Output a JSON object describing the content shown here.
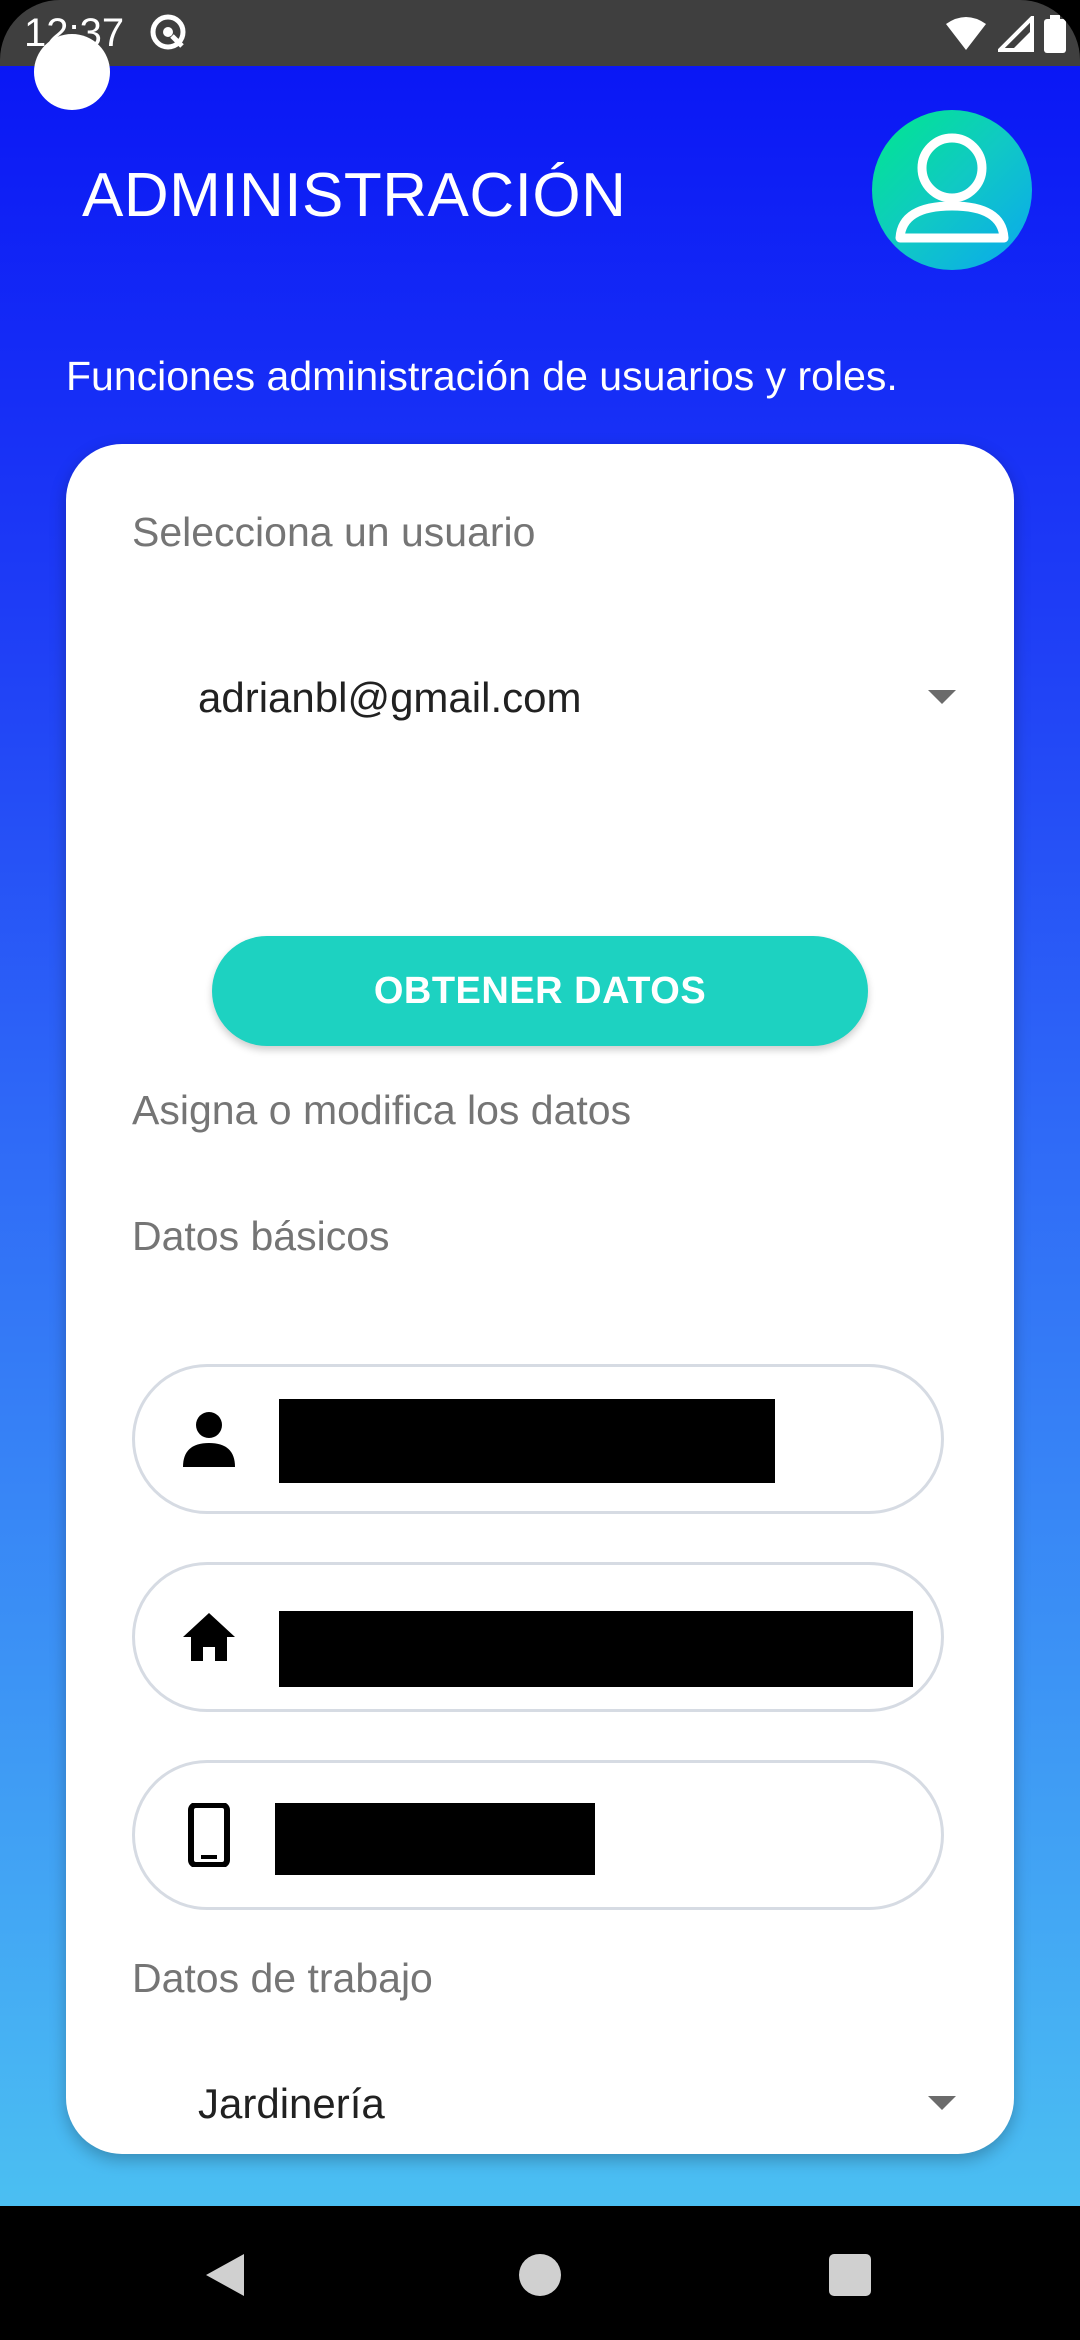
{
  "status_bar": {
    "time": "12:37",
    "vpn_icon": "vpn-key-icon",
    "wifi_icon": "wifi-icon",
    "signal_icon": "signal-icon",
    "battery_icon": "battery-icon"
  },
  "header": {
    "title": "ADMINISTRACIÓN",
    "avatar_icon": "user-account-icon"
  },
  "subtitle": "Funciones administración de usuarios y roles.",
  "card": {
    "select_user_label": "Selecciona un usuario",
    "selected_user": "adrianbl@gmail.com",
    "get_data_button": "OBTENER DATOS",
    "assign_label": "Asigna o modifica los datos",
    "basic_data_label": "Datos básicos",
    "fields": [
      {
        "icon": "person-icon",
        "value": "redacted"
      },
      {
        "icon": "home-icon",
        "value": "redacted"
      },
      {
        "icon": "phone-icon",
        "value": "redacted"
      }
    ],
    "work_data_label": "Datos de trabajo",
    "work_selection": "Jardinería"
  },
  "colors": {
    "gradient_top": "#0a17f5",
    "gradient_bottom": "#4bbff2",
    "accent_button": "#1dd2c1",
    "label_gray": "#757575"
  },
  "nav_bar": {
    "back_icon": "back-triangle-icon",
    "home_icon": "home-circle-icon",
    "recents_icon": "recents-square-icon"
  }
}
